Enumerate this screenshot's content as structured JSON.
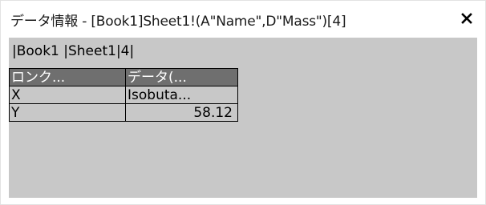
{
  "window": {
    "title": "データ情報 - [Book1]Sheet1!(A\"Name\",D\"Mass\")[4]",
    "close_icon": "close-icon"
  },
  "path": {
    "text": "|Book1 |Sheet1|4|"
  },
  "table": {
    "headers": [
      "ロンク...",
      "データ(..."
    ],
    "rows": [
      [
        "X",
        "Isobuta..."
      ],
      [
        "Y",
        "58.12"
      ]
    ]
  },
  "colors": {
    "panel_bg": "#c8c8c8",
    "header_bg": "#6f6f6f",
    "header_text": "#ffffff"
  }
}
